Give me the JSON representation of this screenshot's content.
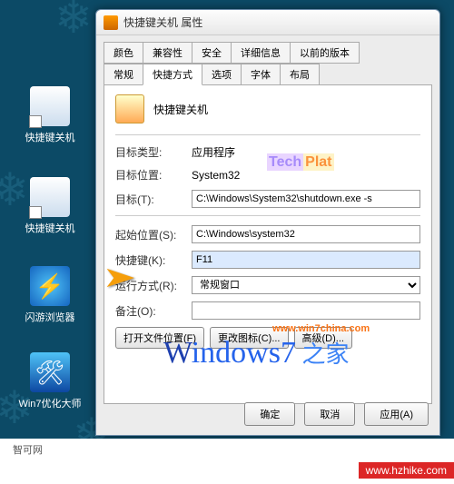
{
  "desktop": {
    "icons": [
      {
        "label": "快捷键关机"
      },
      {
        "label": "快捷键关机"
      },
      {
        "label": "闪游浏览器"
      },
      {
        "label": "Win7优化大师"
      }
    ]
  },
  "dialog": {
    "title": "快捷键关机 属性",
    "tabs_row1": [
      "颜色",
      "兼容性",
      "安全",
      "详细信息",
      "以前的版本"
    ],
    "tabs_row2": [
      "常规",
      "快捷方式",
      "选项",
      "字体",
      "布局"
    ],
    "active_tab": "快捷方式",
    "app_name": "快捷键关机",
    "fields": {
      "target_type": {
        "label": "目标类型:",
        "value": "应用程序"
      },
      "target_loc": {
        "label": "目标位置:",
        "value": "System32"
      },
      "target": {
        "label": "目标(T):",
        "value": "C:\\Windows\\System32\\shutdown.exe -s"
      },
      "start_in": {
        "label": "起始位置(S):",
        "value": "C:\\Windows\\system32"
      },
      "shortcut_key": {
        "label": "快捷键(K):",
        "value": "F11"
      },
      "run": {
        "label": "运行方式(R):",
        "value": "常规窗口"
      },
      "comment": {
        "label": "备注(O):",
        "value": ""
      }
    },
    "buttons": {
      "open_loc": "打开文件位置(F)",
      "change_icon": "更改图标(C)...",
      "advanced": "高级(D)..."
    },
    "dialog_buttons": {
      "ok": "确定",
      "cancel": "取消",
      "apply": "应用(A)"
    }
  },
  "watermarks": {
    "techplat_a": "Tech",
    "techplat_b": "Plat",
    "url": "www.win7china.com",
    "logo_w": "W",
    "logo_rest": "indows7",
    "logo_zh": " 之家"
  },
  "footer": {
    "badge": "www.hzhike.com",
    "credit": "智可网"
  }
}
